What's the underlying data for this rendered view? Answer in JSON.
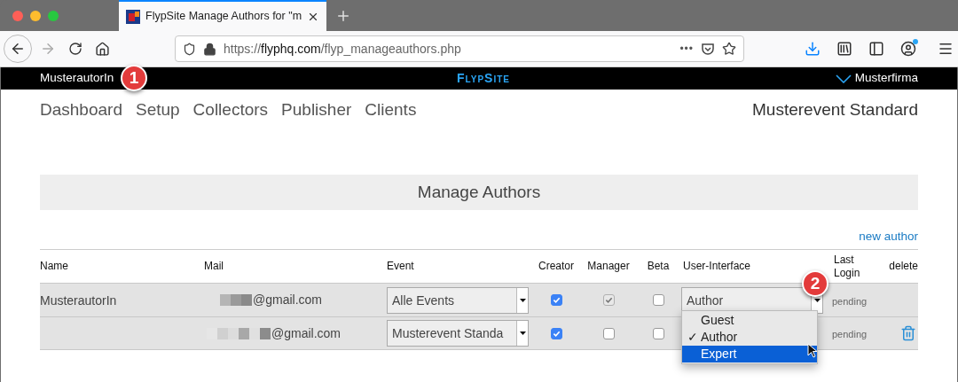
{
  "browser": {
    "tab_title": "FlypSite Manage Authors for \"m",
    "url_scheme": "https://",
    "url_host": "flyphq.com",
    "url_path": "/flyp_manageauthors.php",
    "url_more": "•••"
  },
  "site_bar": {
    "user": "MusterautorIn",
    "logo": "FlypSite",
    "company": "Musterfirma"
  },
  "nav": {
    "items": [
      "Dashboard",
      "Setup",
      "Collectors",
      "Publisher",
      "Clients"
    ],
    "event_name": "Musterevent Standard"
  },
  "title": "Manage Authors",
  "new_author": "new author",
  "table": {
    "columns": [
      "Name",
      "Mail",
      "Event",
      "Creator",
      "Manager",
      "Beta",
      "User-Interface",
      "Last Login",
      "delete"
    ],
    "rows": [
      {
        "name": "MusterautorIn",
        "mail": "@gmail.com",
        "event": "Alle Events",
        "creator": true,
        "manager": {
          "checked": true,
          "disabled": true
        },
        "beta": false,
        "ui": "Author",
        "last_login": "pending",
        "deletable": false
      },
      {
        "mail": "@gmail.com",
        "event": "Musterevent Standa",
        "creator": true,
        "manager": {
          "checked": false,
          "disabled": false
        },
        "beta": false,
        "last_login": "pending",
        "deletable": true
      }
    ]
  },
  "dropdown": {
    "options": [
      {
        "label": "Guest",
        "selected": false,
        "hovered": false
      },
      {
        "label": "Author",
        "selected": true,
        "hovered": false
      },
      {
        "label": "Expert",
        "selected": false,
        "hovered": true
      }
    ],
    "check": "✓"
  },
  "callouts": [
    "1",
    "2"
  ]
}
